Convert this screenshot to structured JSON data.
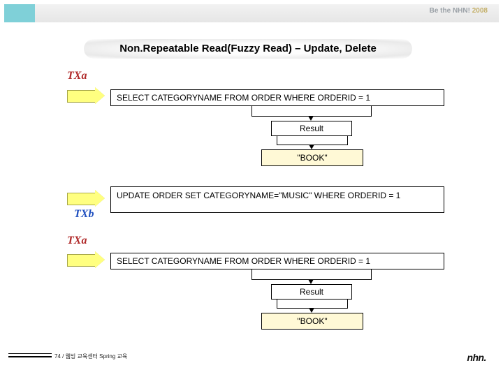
{
  "header": {
    "brand_prefix": "Be the NHN! ",
    "brand_year": "2008"
  },
  "title": "Non.Repeatable Read(Fuzzy Read) – Update, Delete",
  "labels": {
    "txa": "TXa",
    "txb": "TXb",
    "result": "Result"
  },
  "sql": {
    "select": "SELECT CATEGORYNAME FROM ORDER WHERE ORDERID = 1",
    "update": "UPDATE ORDER SET CATEGORYNAME=\"MUSIC\" WHERE ORDERID = 1"
  },
  "values": {
    "result1": "\"BOOK\"",
    "result2": "\"BOOK\""
  },
  "footer": {
    "caption": "74 / 웹빙 교육센터 Spring 교육",
    "logo": "nhn."
  }
}
